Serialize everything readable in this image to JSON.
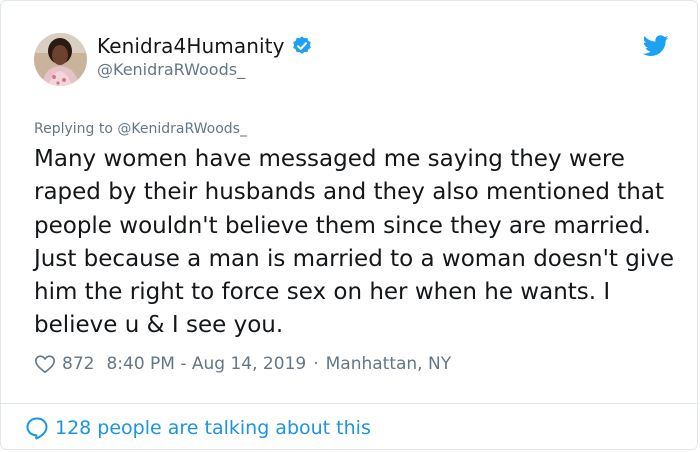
{
  "author": {
    "display_name": "Kenidra4Humanity",
    "handle": "@KenidraRWoods_",
    "verified": true
  },
  "reply": {
    "prefix": "Replying to",
    "mention": "@KenidraRWoods_"
  },
  "tweet": {
    "text": "Many women have messaged me saying they were raped by their husbands and they also mentioned that people wouldn't believe them since they are married. Just because a man is married to a woman doesn't give him the right to force sex on her when he wants. I believe u & I see you."
  },
  "meta": {
    "likes": "872",
    "time": "8:40 PM - Aug 14, 2019",
    "separator": "·",
    "location": "Manhattan, NY"
  },
  "footer": {
    "talking": "128 people are talking about this"
  },
  "icons": {
    "verified": "verified-badge-icon",
    "brand": "twitter-bird-icon",
    "like": "heart-icon",
    "conversation": "speech-bubble-icon"
  },
  "colors": {
    "brand_blue": "#1da1f2",
    "link_blue": "#1b95e0",
    "muted": "#657786",
    "text": "#14171a",
    "border": "#e1e8ed"
  }
}
